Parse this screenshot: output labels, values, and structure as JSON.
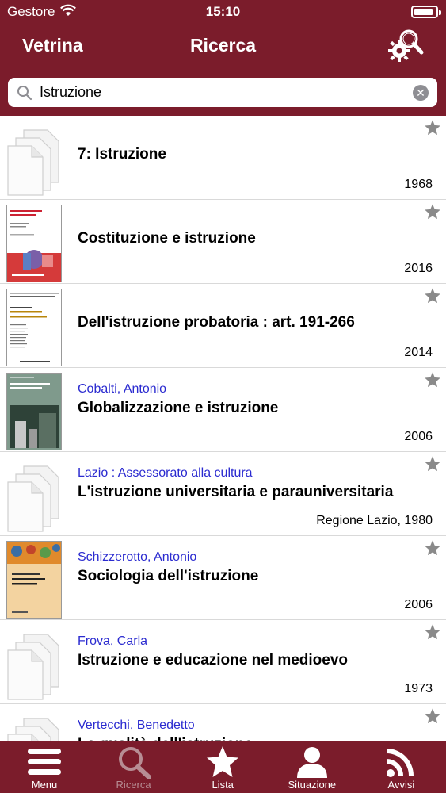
{
  "status_bar": {
    "carrier": "Gestore",
    "time": "15:10",
    "battery_level": 0.9
  },
  "nav": {
    "back_label": "Vetrina",
    "title": "Ricerca",
    "gear_icon": "gear-search-icon"
  },
  "search": {
    "value": "Istruzione",
    "placeholder": ""
  },
  "results": [
    {
      "author": "",
      "title": "7: Istruzione",
      "year": "1968",
      "cover": "placeholder"
    },
    {
      "author": "",
      "title": "Costituzione e istruzione",
      "year": "2016",
      "cover": "cover-sdp"
    },
    {
      "author": "",
      "title": "Dell'istruzione probatoria : art. 191-266",
      "year": "2014",
      "cover": "cover-white"
    },
    {
      "author": "Cobalti, Antonio",
      "title": "Globalizzazione e istruzione",
      "year": "2006",
      "cover": "cover-green"
    },
    {
      "author": "Lazio : Assessorato alla cultura",
      "title": "L'istruzione universitaria e parauniversitaria",
      "year": "Regione Lazio, 1980",
      "cover": "placeholder"
    },
    {
      "author": "Schizzerotto, Antonio",
      "title": "Sociologia dell'istruzione",
      "year": "2006",
      "cover": "cover-orange"
    },
    {
      "author": "Frova, Carla",
      "title": "Istruzione e educazione nel medioevo",
      "year": "1973",
      "cover": "placeholder"
    },
    {
      "author": "Vertecchi, Benedetto",
      "title": "La qualità dell'istruzione",
      "year": "",
      "cover": "placeholder"
    }
  ],
  "tabs": [
    {
      "label": "Menu",
      "icon": "menu-icon",
      "active": false
    },
    {
      "label": "Ricerca",
      "icon": "search-icon",
      "active": true
    },
    {
      "label": "Lista",
      "icon": "star-icon",
      "active": false
    },
    {
      "label": "Situazione",
      "icon": "user-icon",
      "active": false
    },
    {
      "label": "Avvisi",
      "icon": "rss-icon",
      "active": false
    }
  ],
  "colors": {
    "brand": "#7b1c2b",
    "author_link": "#2b2bd0",
    "tab_inactive": "#b78d94"
  }
}
